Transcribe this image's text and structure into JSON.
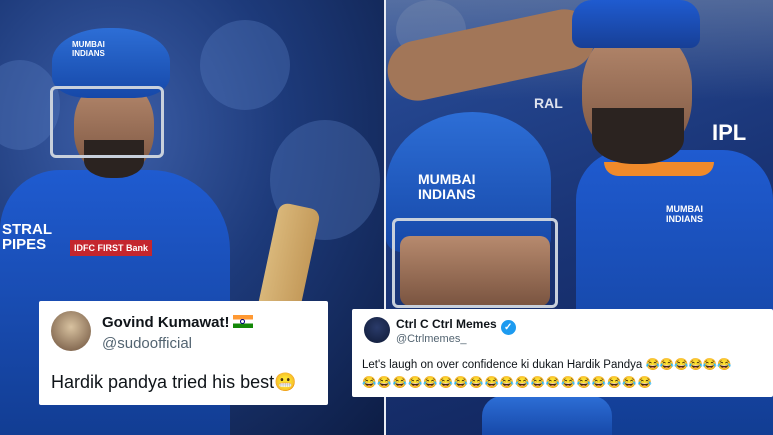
{
  "left_photo": {
    "jersey_text": "STRAL\nPIPES",
    "sponsor": "IDFC FIRST Bank",
    "helmet_logo": "MUMBAI INDIANS"
  },
  "right_photo": {
    "helmet_logo": "MUMBAI INDIANS",
    "ipl_text": "IPL",
    "jersey_text": "RAL"
  },
  "tweet_left": {
    "name": "Govind Kumawat!",
    "flag": "india-flag-icon",
    "handle": "@sudoofficial",
    "text": "Hardik pandya tried his best",
    "emoji": "😬"
  },
  "tweet_right": {
    "name": "Ctrl C Ctrl Memes",
    "verified": "verified-badge-icon",
    "handle": "@Ctrlmemes_",
    "text": "Let's laugh on over confidence ki dukan Hardik Pandya 😂😂😂😂😂😂",
    "text_line2": "😂😂😂😂😂😂😂😂😂😂😂😂😂😂😂😂😂😂😂"
  },
  "colors": {
    "mi_blue": "#1f5bd0",
    "verified": "#1d9bf0"
  }
}
